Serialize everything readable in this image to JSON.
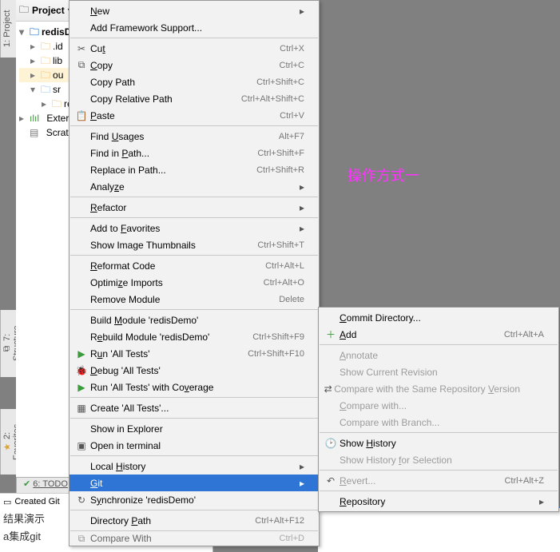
{
  "sidebar_tabs": {
    "project": "1: Project",
    "structure": "7: Structure",
    "favorites": "2: Favorites"
  },
  "project_panel": {
    "title": "Project",
    "tree": {
      "root": "redisD",
      "idea": ".id",
      "lib": "lib",
      "out": "ou",
      "src": "sr",
      "re": "re",
      "extern": "Extern",
      "scratch": "Scratc"
    }
  },
  "bottom": {
    "todo": "6: TODO",
    "status": "Created Git",
    "cn1": "结果演示",
    "cn2": "a集成git"
  },
  "annotation": "操作方式一",
  "ctx1": [
    {
      "t": "item",
      "label": "New",
      "u": "N",
      "sc": "",
      "sub": true
    },
    {
      "t": "item",
      "label": "Add Framework Support...",
      "u": "",
      "sc": ""
    },
    {
      "t": "sep"
    },
    {
      "t": "item",
      "label": "Cut",
      "u": "t",
      "sc": "Ctrl+X",
      "ico": "✂"
    },
    {
      "t": "item",
      "label": "Copy",
      "u": "C",
      "sc": "Ctrl+C",
      "ico": "⧉"
    },
    {
      "t": "item",
      "label": "Copy Path",
      "u": "",
      "sc": "Ctrl+Shift+C"
    },
    {
      "t": "item",
      "label": "Copy Relative Path",
      "u": "",
      "sc": "Ctrl+Alt+Shift+C"
    },
    {
      "t": "item",
      "label": "Paste",
      "u": "P",
      "sc": "Ctrl+V",
      "ico": "📋"
    },
    {
      "t": "sep"
    },
    {
      "t": "item",
      "label": "Find Usages",
      "u": "U",
      "sc": "Alt+F7"
    },
    {
      "t": "item",
      "label": "Find in Path...",
      "u": "P",
      "sc": "Ctrl+Shift+F"
    },
    {
      "t": "item",
      "label": "Replace in Path...",
      "u": "",
      "sc": "Ctrl+Shift+R"
    },
    {
      "t": "item",
      "label": "Analyze",
      "u": "z",
      "sc": "",
      "sub": true
    },
    {
      "t": "sep"
    },
    {
      "t": "item",
      "label": "Refactor",
      "u": "R",
      "sc": "",
      "sub": true
    },
    {
      "t": "sep"
    },
    {
      "t": "item",
      "label": "Add to Favorites",
      "u": "F",
      "sc": "",
      "sub": true
    },
    {
      "t": "item",
      "label": "Show Image Thumbnails",
      "u": "",
      "sc": "Ctrl+Shift+T"
    },
    {
      "t": "sep"
    },
    {
      "t": "item",
      "label": "Reformat Code",
      "u": "R",
      "sc": "Ctrl+Alt+L"
    },
    {
      "t": "item",
      "label": "Optimize Imports",
      "u": "z",
      "sc": "Ctrl+Alt+O"
    },
    {
      "t": "item",
      "label": "Remove Module",
      "u": "",
      "sc": "Delete"
    },
    {
      "t": "sep"
    },
    {
      "t": "item",
      "label": "Build Module 'redisDemo'",
      "u": "M",
      "sc": ""
    },
    {
      "t": "item",
      "label": "Rebuild Module 'redisDemo'",
      "u": "e",
      "sc": "Ctrl+Shift+F9"
    },
    {
      "t": "item",
      "label": "Run 'All Tests'",
      "u": "u",
      "sc": "Ctrl+Shift+F10",
      "ico": "▶",
      "icocolor": "#3a9b3a"
    },
    {
      "t": "item",
      "label": "Debug 'All Tests'",
      "u": "D",
      "sc": "",
      "ico": "🐞",
      "icocolor": "#3a9b3a"
    },
    {
      "t": "item",
      "label": "Run 'All Tests' with Coverage",
      "u": "v",
      "sc": "",
      "ico": "▶",
      "icocolor": "#3a9b3a"
    },
    {
      "t": "sep"
    },
    {
      "t": "item",
      "label": "Create 'All Tests'...",
      "u": "",
      "sc": "",
      "ico": "▦"
    },
    {
      "t": "sep"
    },
    {
      "t": "item",
      "label": "Show in Explorer",
      "u": "",
      "sc": ""
    },
    {
      "t": "item",
      "label": "Open in terminal",
      "u": "",
      "sc": "",
      "ico": "▣"
    },
    {
      "t": "sep"
    },
    {
      "t": "item",
      "label": "Local History",
      "u": "H",
      "sc": "",
      "sub": true
    },
    {
      "t": "item",
      "label": "Git",
      "u": "G",
      "sc": "",
      "sub": true,
      "sel": true
    },
    {
      "t": "item",
      "label": "Synchronize 'redisDemo'",
      "u": "y",
      "sc": "",
      "ico": "↻"
    },
    {
      "t": "sep"
    },
    {
      "t": "item",
      "label": "Directory Path",
      "u": "P",
      "sc": "Ctrl+Alt+F12"
    },
    {
      "t": "sep"
    },
    {
      "t": "item",
      "label": "Compare With",
      "u": "",
      "sc": "Ctrl+D",
      "ico": "⧉",
      "cut": true
    }
  ],
  "ctx2": [
    {
      "t": "item",
      "label": "Commit Directory...",
      "u": "C",
      "sc": ""
    },
    {
      "t": "item",
      "label": "Add",
      "u": "A",
      "sc": "Ctrl+Alt+A",
      "ico": "＋",
      "icocolor": "#3a9b3a"
    },
    {
      "t": "sep"
    },
    {
      "t": "item",
      "label": "Annotate",
      "u": "A",
      "sc": "",
      "dis": true
    },
    {
      "t": "item",
      "label": "Show Current Revision",
      "u": "",
      "sc": "",
      "dis": true
    },
    {
      "t": "item",
      "label": "Compare with the Same Repository Version",
      "u": "V",
      "sc": "",
      "dis": true,
      "ico": "⇄"
    },
    {
      "t": "item",
      "label": "Compare with...",
      "u": "C",
      "sc": "",
      "dis": true
    },
    {
      "t": "item",
      "label": "Compare with Branch...",
      "u": "",
      "sc": "",
      "dis": true
    },
    {
      "t": "sep"
    },
    {
      "t": "item",
      "label": "Show History",
      "u": "H",
      "sc": "",
      "ico": "🕑"
    },
    {
      "t": "item",
      "label": "Show History for Selection",
      "u": "f",
      "sc": "",
      "dis": true
    },
    {
      "t": "sep"
    },
    {
      "t": "item",
      "label": "Revert...",
      "u": "R",
      "sc": "Ctrl+Alt+Z",
      "dis": true,
      "ico": "↶"
    },
    {
      "t": "sep"
    },
    {
      "t": "item",
      "label": "Repository",
      "u": "R",
      "sc": "",
      "sub": true
    }
  ]
}
